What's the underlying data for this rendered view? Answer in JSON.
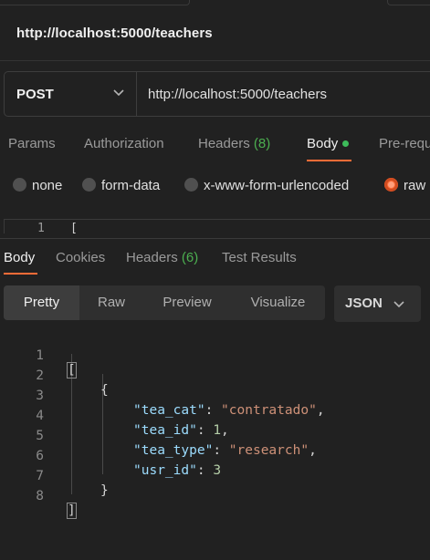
{
  "request": {
    "title": "http://localhost:5000/teachers",
    "method": "POST",
    "url": "http://localhost:5000/teachers",
    "tabs": [
      {
        "label": "Params"
      },
      {
        "label": "Authorization"
      },
      {
        "label": "Headers",
        "count": "(8)"
      },
      {
        "label": "Body"
      },
      {
        "label": "Pre-requ"
      }
    ],
    "body_types": [
      {
        "label": "none"
      },
      {
        "label": "form-data"
      },
      {
        "label": "x-www-form-urlencoded"
      },
      {
        "label": "raw",
        "selected": true
      }
    ],
    "editor_first_line": {
      "number": "1",
      "text": "["
    }
  },
  "response": {
    "tabs": [
      {
        "label": "Body"
      },
      {
        "label": "Cookies"
      },
      {
        "label": "Headers",
        "count": "(6)"
      },
      {
        "label": "Test Results"
      }
    ],
    "views": [
      "Pretty",
      "Raw",
      "Preview",
      "Visualize"
    ],
    "format": "JSON",
    "lines": [
      "1",
      "2",
      "3",
      "4",
      "5",
      "6",
      "7",
      "8"
    ],
    "json": {
      "open_array": "[",
      "open_obj": "{",
      "fields": [
        {
          "key": "\"tea_cat\"",
          "value": "\"contratado\"",
          "type": "string",
          "comma": ","
        },
        {
          "key": "\"tea_id\"",
          "value": "1",
          "type": "number",
          "comma": ","
        },
        {
          "key": "\"tea_type\"",
          "value": "\"research\"",
          "type": "string",
          "comma": ","
        },
        {
          "key": "\"usr_id\"",
          "value": "3",
          "type": "number",
          "comma": ""
        }
      ],
      "close_obj": "}",
      "close_array": "]"
    }
  },
  "colors": {
    "accent": "#ff6c37",
    "count_green": "#4caf50",
    "json_key": "#9cdcfe",
    "json_string": "#ce9178",
    "json_number": "#b5cea8"
  },
  "icons": {
    "method_dropdown": "chevron-down-icon",
    "format_dropdown": "chevron-down-icon"
  }
}
